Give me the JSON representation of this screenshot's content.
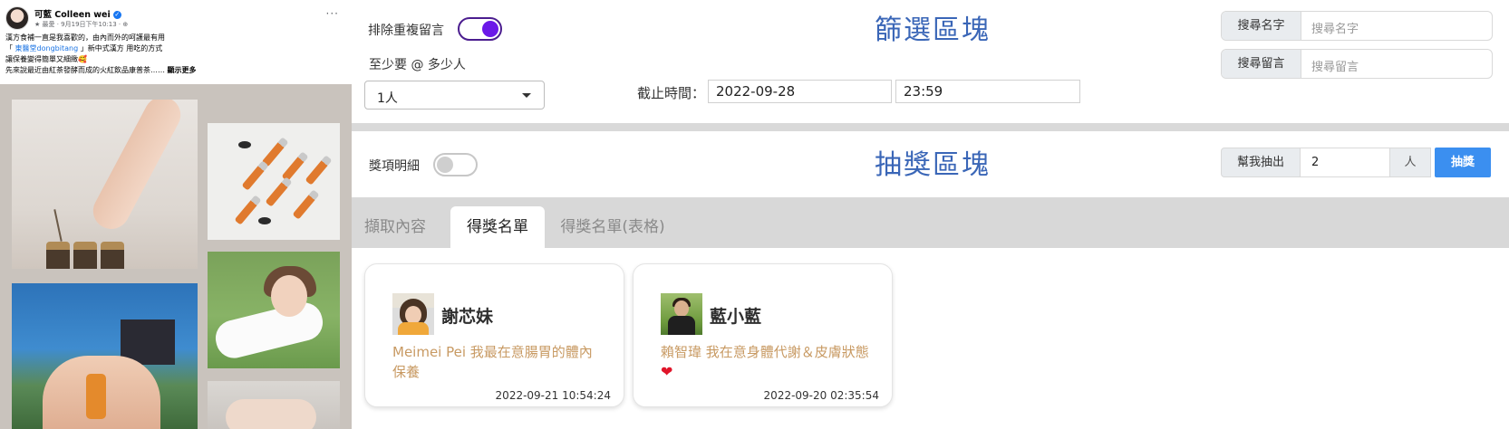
{
  "post": {
    "author": "可藍 Colleen wei",
    "meta": "★ 最愛 · 9月19日下午10:13 · ⊕",
    "more": "···",
    "text_lines": {
      "l1": "漢方食補一直是我喜歡的，由內而外的呵護最有用",
      "l2_pre": "「 ",
      "l2_link": "東醫堂dongbitang",
      "l2_post": " 」新中式漢方 用吃的方式",
      "l3": "讓保養變得簡單又細緻🥰",
      "l4_pre": "先來說最近由紅茶發酵而成的火紅飲品康普茶……",
      "l4_more": "顯示更多"
    }
  },
  "filter": {
    "dedupe_label": "排除重複留言",
    "dedupe_on": true,
    "min_label": "至少要 @ 多少人",
    "min_value": "1人",
    "title": "篩選區塊",
    "deadline_label": "截止時間：",
    "deadline_date": "2022-09-28",
    "deadline_time": "23:59",
    "search_name_label": "搜尋名字",
    "search_name_placeholder": "搜尋名字",
    "search_comment_label": "搜尋留言",
    "search_comment_placeholder": "搜尋留言"
  },
  "draw": {
    "prize_label": "獎項明細",
    "prize_on": false,
    "title": "抽獎區塊",
    "draw_for_label": "幫我抽出",
    "count": "2",
    "unit": "人",
    "button": "抽獎"
  },
  "tabs": {
    "fetch": "擷取內容",
    "winners": "得獎名單",
    "winners_table": "得獎名單(表格)",
    "active": "winners"
  },
  "winners": [
    {
      "name": "謝芯妹",
      "comment": "Meimei Pei 我最在意腸胃的體內保養",
      "time": "2022-09-21 10:54:24"
    },
    {
      "name": "藍小藍",
      "comment": "賴智瑋 我在意身體代謝＆皮膚狀態",
      "emoji": "❤",
      "time": "2022-09-20 02:35:54"
    }
  ],
  "colors": {
    "accent": "#3b8ff0",
    "title": "#3a66b7",
    "toggle_on": "#6b18e8",
    "comment": "#c89a63"
  }
}
